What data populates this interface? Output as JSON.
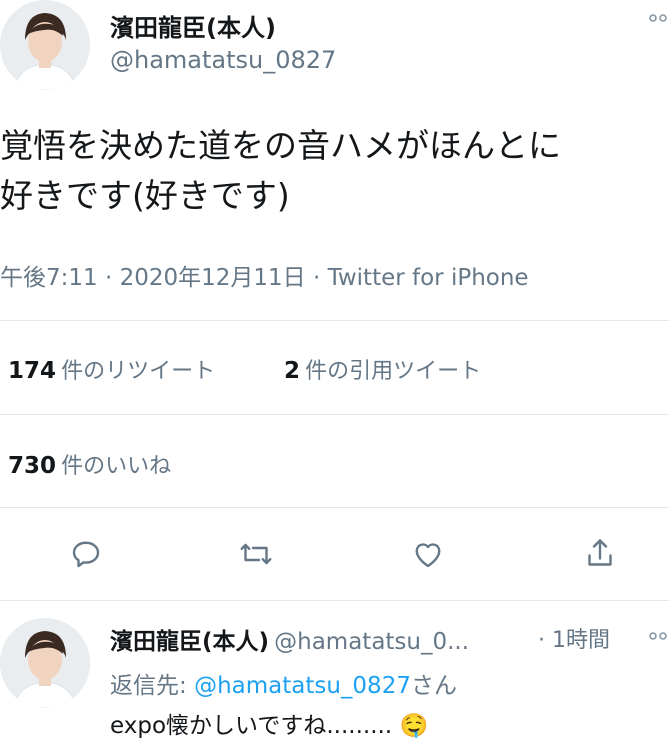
{
  "tweet": {
    "author_name": "濱田龍臣(本人)",
    "author_handle": "@hamatatsu_0827",
    "more_icon": "ellipsis-icon",
    "text_line1": "覚悟を決めた道をの音ハメがほんとに",
    "text_line2": "好きです(好きです)",
    "time": "午後7:11",
    "sep1": "·",
    "date": "2020年12月11日",
    "sep2": "·",
    "client": "Twitter for iPhone"
  },
  "stats": {
    "retweets_count": "174",
    "retweets_label": "件のリツイート",
    "quotes_count": "2",
    "quotes_label": "件の引用ツイート",
    "likes_count": "730",
    "likes_label": "件のいいね"
  },
  "actions": {
    "reply_icon": "comment-icon",
    "retweet_icon": "retweet-icon",
    "like_icon": "heart-icon",
    "share_icon": "share-icon"
  },
  "reply": {
    "author_name": "濱田龍臣(本人)",
    "author_handle": "@hamatatsu_0...",
    "sep": "·",
    "time": "1時間",
    "replying_prefix": "返信先:",
    "replying_to": "@hamatatsu_0827",
    "replying_suffix": "さん",
    "text": "expo懐かしいですね.........",
    "emoji": "🤤"
  },
  "colors": {
    "accent": "#1da1f2",
    "secondary_text": "#657786",
    "divider": "#e1e8ed"
  }
}
